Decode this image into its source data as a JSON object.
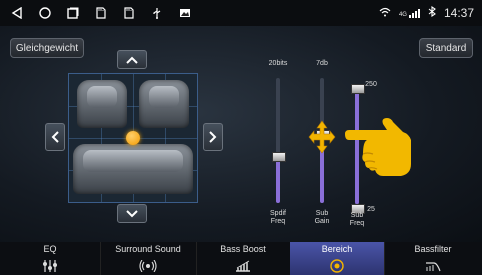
{
  "status": {
    "left_icons": [
      "back-icon",
      "home-icon",
      "recent-apps-icon",
      "sd-card-icon",
      "sd-card-2-icon",
      "usb-icon",
      "image-icon"
    ],
    "right": {
      "wifi": "wifi-icon",
      "signal_label": "4G",
      "bluetooth": "bluetooth-icon",
      "time": "14:37"
    }
  },
  "toolbar": {
    "balance_label": "Gleichgewicht",
    "standard_label": "Standard"
  },
  "seats": {
    "up": "chevron-up-icon",
    "down": "chevron-down-icon",
    "left": "chevron-left-icon",
    "right": "chevron-right-icon"
  },
  "sliders": [
    {
      "top_label": "20bits",
      "bottom_label": "Spdif\nFreq",
      "level": 0.38
    },
    {
      "top_label": "7db",
      "bottom_label": "Sub\nGain",
      "level": 0.55
    },
    {
      "top_label": "",
      "bottom_label": "Sub\nFreq",
      "level": 0.75,
      "value_upper": "250",
      "value_lower": "25"
    }
  ],
  "tabs": [
    {
      "label": "EQ",
      "icon": "equalizer-icon"
    },
    {
      "label": "Surround Sound",
      "icon": "surround-icon"
    },
    {
      "label": "Bass Boost",
      "icon": "bass-boost-icon"
    },
    {
      "label": "Bereich",
      "icon": "target-icon",
      "active": true
    },
    {
      "label": "Bassfilter",
      "icon": "bassfilter-icon"
    }
  ],
  "colors": {
    "accent": "#f2a000",
    "active_tab": "#3d4a9a"
  }
}
